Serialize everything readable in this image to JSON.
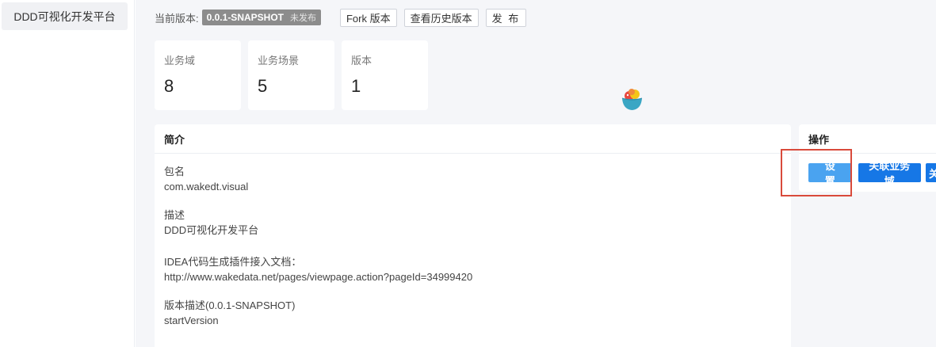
{
  "sidebar": {
    "items": [
      {
        "label": "DDD可视化开发平台"
      }
    ]
  },
  "version": {
    "label": "当前版本:",
    "tag": "0.0.1-SNAPSHOT",
    "status": "未发布",
    "fork_label": "Fork 版本",
    "history_label": "查看历史版本",
    "publish_label": "发 布"
  },
  "stats": [
    {
      "label": "业务域",
      "value": "8"
    },
    {
      "label": "业务场景",
      "value": "5"
    },
    {
      "label": "版本",
      "value": "1"
    }
  ],
  "intro": {
    "title": "简介",
    "fields": [
      {
        "key": "包名",
        "value": "com.wakedt.visual"
      },
      {
        "key": "描述",
        "value": "DDD可视化开发平台"
      },
      {
        "key": "IDEA代码生成插件接入文档：",
        "value": "http://www.wakedata.net/pages/viewpage.action?pageId=34999420"
      },
      {
        "key": "版本描述(0.0.1-SNAPSHOT)",
        "value": "startVersion"
      }
    ]
  },
  "ops": {
    "title": "操作",
    "settings_label": "设 置",
    "link_domain_label": "关联业务域",
    "more_label": "关"
  },
  "colors": {
    "accent": "#1677e6",
    "accent_light": "#4aa3f0",
    "highlight": "#d94a3b",
    "tag_bg": "#8c8c8c"
  },
  "icons": {
    "avatar": "fruit-bowl-icon"
  }
}
